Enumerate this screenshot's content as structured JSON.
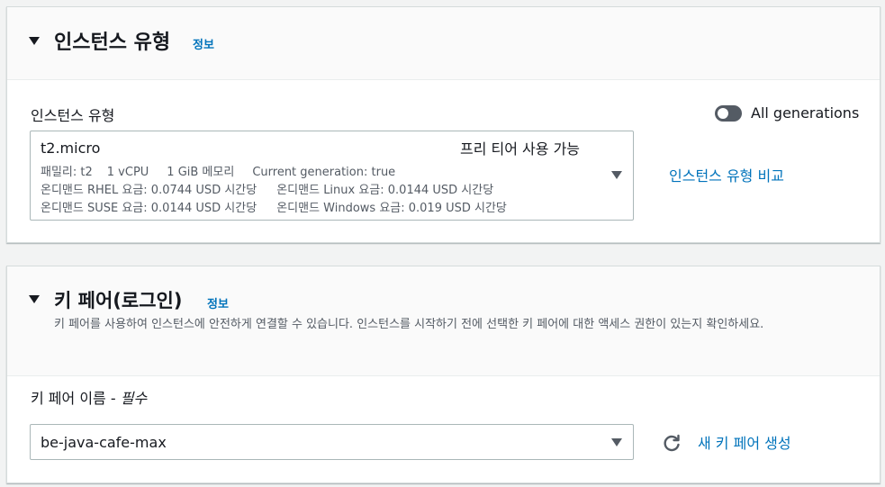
{
  "instance_type_section": {
    "title": "인스턴스 유형",
    "info_link": "정보",
    "field_label": "인스턴스 유형",
    "toggle_label": "All generations",
    "toggle_on": false,
    "selected": {
      "name": "t2.micro",
      "free_tier": "프리 티어 사용 가능",
      "family": "패밀리: t2",
      "vcpu": "1 vCPU",
      "memory": "1 GiB 메모리",
      "generation": "Current generation: true",
      "rhel_price": "온디맨드 RHEL 요금: 0.0744 USD 시간당",
      "linux_price": "온디맨드 Linux 요금: 0.0144 USD 시간당",
      "suse_price": "온디맨드 SUSE 요금: 0.0144 USD 시간당",
      "windows_price": "온디맨드 Windows 요금: 0.019 USD 시간당"
    },
    "compare_link": "인스턴스 유형 비교"
  },
  "keypair_section": {
    "title": "키 페어(로그인)",
    "info_link": "정보",
    "description": "키 페어를 사용하여 인스턴스에 안전하게 연결할 수 있습니다. 인스턴스를 시작하기 전에 선택한 키 페어에 대한 액세스 권한이 있는지 확인하세요.",
    "field_label": "키 페어 이름 - ",
    "field_required": "필수",
    "selected_value": "be-java-cafe-max",
    "new_keypair_link": "새 키 페어 생성"
  },
  "icons": {
    "caret": "caret-down-icon",
    "refresh": "refresh-icon"
  },
  "colors": {
    "link": "#0073bb",
    "toggle_off": "#545b64",
    "background": "#f2f3f3"
  }
}
